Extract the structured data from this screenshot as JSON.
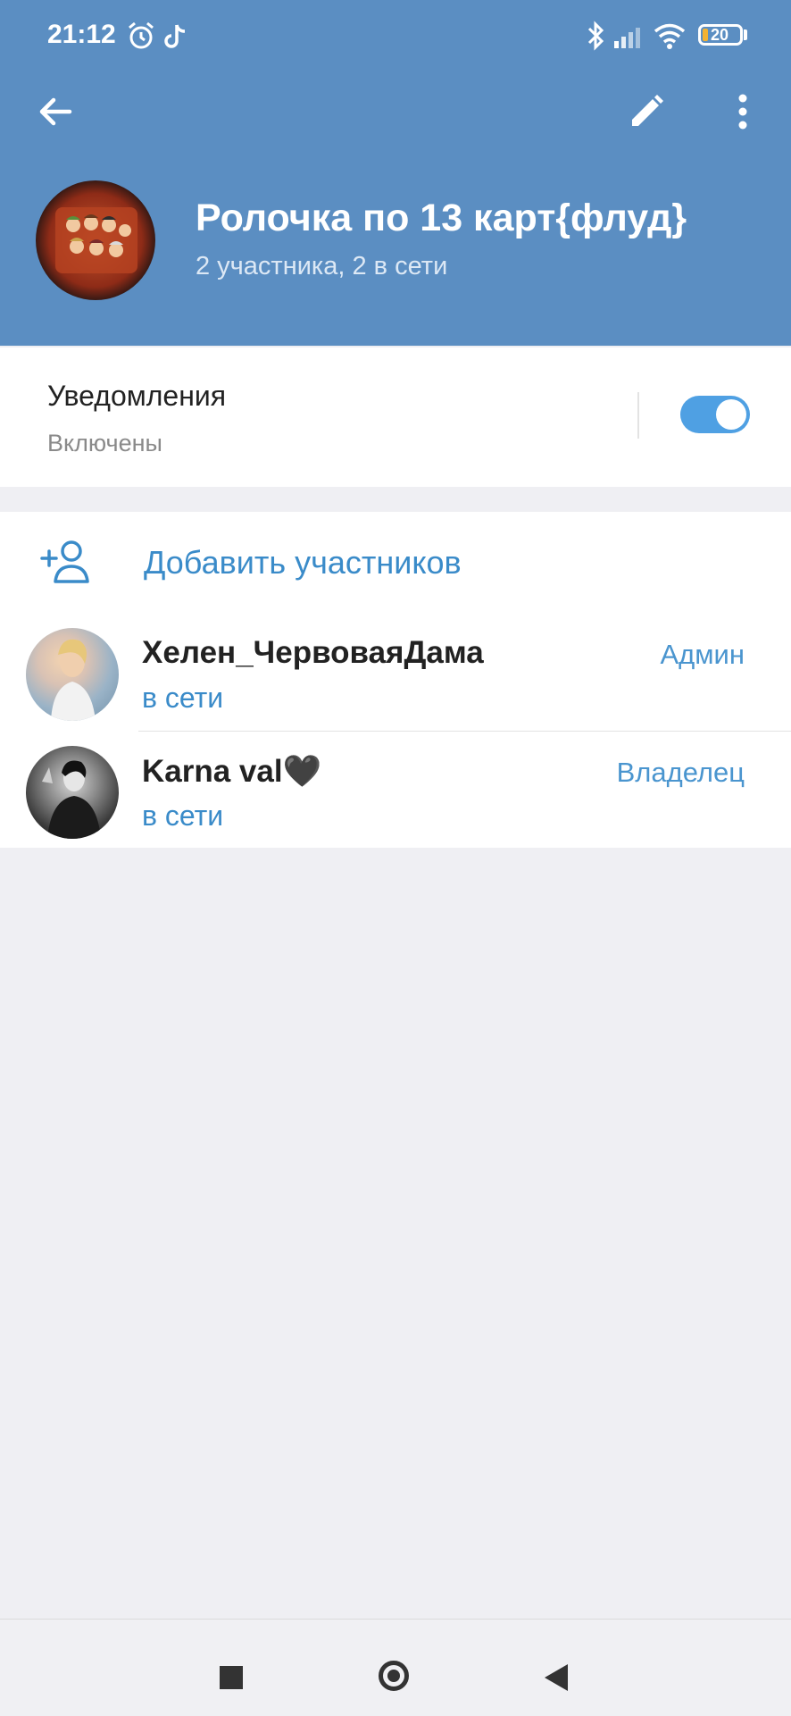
{
  "status_bar": {
    "time": "21:12",
    "icons": [
      "alarm-icon",
      "tiktok-icon",
      "bluetooth-icon",
      "signal-icon",
      "wifi-icon"
    ],
    "battery": "20"
  },
  "header": {
    "back_icon": "arrow-left-icon",
    "edit_icon": "pencil-icon",
    "more_icon": "more-vertical-icon",
    "title": "Ролочка по 13 карт{флуд}",
    "subtitle": "2 участника, 2 в сети",
    "bg_color": "#5b8ec2"
  },
  "notifications": {
    "title": "Уведомления",
    "status": "Включены",
    "enabled": true
  },
  "members_section": {
    "add_label": "Добавить участников",
    "members": [
      {
        "name": "Хелен_ЧервоваяДама",
        "status": "в сети",
        "role": "Админ"
      },
      {
        "name": "Karna val🖤",
        "status": "в сети",
        "role": "Владелец"
      }
    ]
  },
  "accent_color": "#3a8bc9",
  "bottom_nav": {
    "buttons": [
      "recents-square-icon",
      "home-circle-icon",
      "back-triangle-icon"
    ]
  }
}
